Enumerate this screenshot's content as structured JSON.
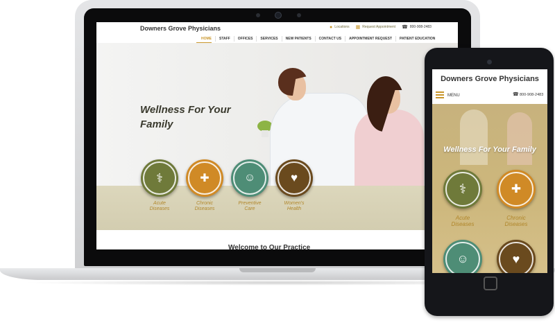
{
  "laptop_site": {
    "brand": "Downers Grove Physicians",
    "top_links": {
      "locations": "Locations",
      "request_appointment": "Request Appointment",
      "phone": "800-908-2483"
    },
    "nav": [
      "HOME",
      "STAFF",
      "OFFICES",
      "SERVICES",
      "NEW PATIENTS",
      "CONTACT US",
      "APPOINTMENT REQUEST",
      "PATIENT EDUCATION"
    ],
    "hero_title_line1": "Wellness For Your",
    "hero_title_line2": "Family",
    "services": [
      {
        "line1": "Acute",
        "line2": "Diseases",
        "icon": "stethoscope-icon",
        "color": "#6f7a3a"
      },
      {
        "line1": "Chronic",
        "line2": "Diseases",
        "icon": "medkit-icon",
        "color": "#d08a26"
      },
      {
        "line1": "Preventive",
        "line2": "Care",
        "icon": "nurse-icon",
        "color": "#4e8d76"
      },
      {
        "line1": "Women's",
        "line2": "Health",
        "icon": "heart-pulse-icon",
        "color": "#6a4a1e"
      }
    ],
    "welcome_text": "Welcome to Our Practice"
  },
  "phone_site": {
    "brand": "Downers Grove Physicians",
    "menu_label": "MENU",
    "phone": "800-908-2483",
    "hero_title": "Wellness For Your Family",
    "services": [
      {
        "line1": "Acute",
        "line2": "Diseases",
        "icon": "stethoscope-icon",
        "color": "#6f7a3a"
      },
      {
        "line1": "Chronic",
        "line2": "Diseases",
        "icon": "medkit-icon",
        "color": "#d08a26"
      },
      {
        "line1": "",
        "line2": "",
        "icon": "nurse-icon",
        "color": "#4e8d76"
      },
      {
        "line1": "",
        "line2": "",
        "icon": "heart-pulse-icon",
        "color": "#6a4a1e"
      }
    ]
  },
  "colors": {
    "accent_gold": "#c9962b",
    "band": "#d8d2b6",
    "text_dark": "#333333"
  }
}
